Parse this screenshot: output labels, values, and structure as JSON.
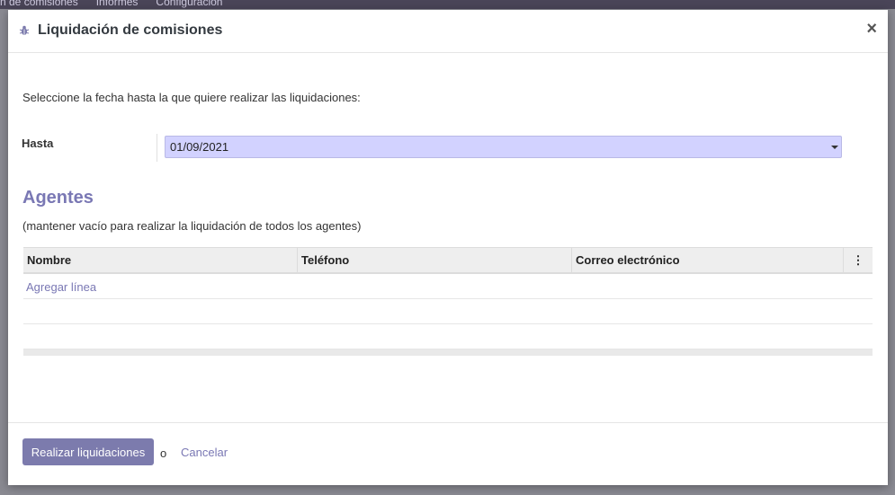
{
  "backdrop": {
    "menu": [
      "n de comisiones",
      "Informes",
      "Configuración"
    ]
  },
  "modal": {
    "title": "Liquidación de comisiones",
    "close_label": "×"
  },
  "form": {
    "intro": "Seleccione la fecha hasta la que quiere realizar las liquidaciones:",
    "date_label": "Hasta",
    "date_value": "01/09/2021"
  },
  "agents": {
    "title": "Agentes",
    "subtitle": "(mantener vacío para realizar la liquidación de todos los agentes)",
    "columns": [
      "Nombre",
      "Teléfono",
      "Correo electrónico"
    ],
    "options_icon": "⋮",
    "add_line": "Agregar línea"
  },
  "footer": {
    "primary_label": "Realizar liquidaciones",
    "or_text": "o",
    "cancel_label": "Cancelar"
  },
  "icons": {
    "title_icon": "bug-icon",
    "options_icon": "vertical-dots-icon",
    "caret_icon": "caret-down-icon"
  },
  "colors": {
    "accent": "#7c7bad",
    "link": "#7a78b4",
    "date_field": "#d2d2ff"
  }
}
